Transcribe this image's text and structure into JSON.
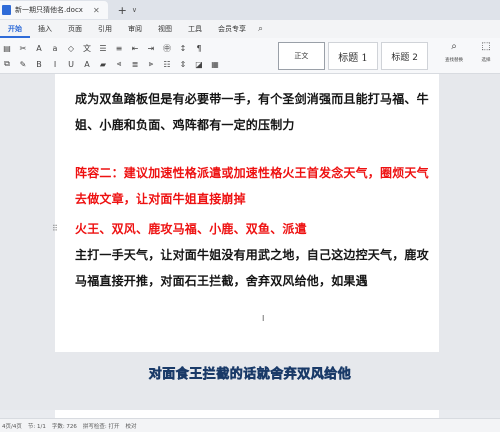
{
  "titlebar": {
    "doc_name": "新一期只猜他名.docx",
    "add": "+",
    "menu": "∨"
  },
  "menu": {
    "items": [
      {
        "label": "开始",
        "active": true
      },
      {
        "label": "插入"
      },
      {
        "label": "页面"
      },
      {
        "label": "引用"
      },
      {
        "label": "审阅"
      },
      {
        "label": "视图"
      },
      {
        "label": "工具"
      },
      {
        "label": "会员专享"
      }
    ]
  },
  "toolbar": {
    "style_normal": "正文",
    "style_h1": "标题 1",
    "style_h2": "标题 2",
    "find_label": "查找替换",
    "select_label": "选择"
  },
  "document": {
    "p1": "成为双鱼踏板但是有必要带一手，有个圣剑消强而且能打马福、牛姐、小鹿和负面、鸡阵都有一定的压制力",
    "p2": "阵容二：建议加速性格派遣或加速性格火王首发念天气，圈烦天气去做文章，让对面牛姐直接崩掉",
    "p3_prefix": "火王、双风、鹿攻马福、小鹿、双鱼、",
    "p3_suffix": "派遣",
    "p4": "主打一手天气，让对面牛姐没有用武之地，自己这边控天气，鹿攻马福直接开推，对面石王拦截，舍弃双风给他，如果遇"
  },
  "subtitle": "对面食王拦截的话就舍弃双风给他",
  "statusbar": {
    "page": "4页/4页",
    "section": "节: 1/1",
    "words": "字数: 726",
    "spell": "拼写检查: 打开",
    "proof": "校对"
  },
  "colors": {
    "accent": "#2f6bd8",
    "red_text": "#ee1111",
    "subtitle_fill": "#7fd0ff"
  }
}
